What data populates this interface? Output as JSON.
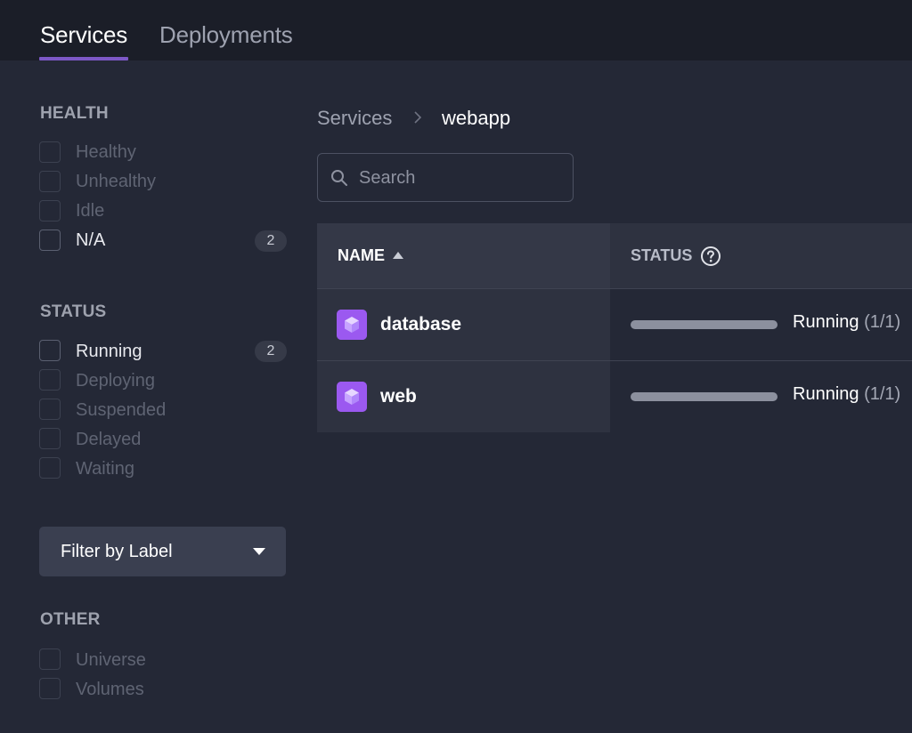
{
  "tabs": [
    {
      "label": "Services",
      "active": true
    },
    {
      "label": "Deployments",
      "active": false
    }
  ],
  "sidebar": {
    "health": {
      "title": "HEALTH",
      "items": [
        {
          "label": "Healthy",
          "count": ""
        },
        {
          "label": "Unhealthy",
          "count": ""
        },
        {
          "label": "Idle",
          "count": ""
        },
        {
          "label": "N/A",
          "count": "2"
        }
      ]
    },
    "status": {
      "title": "STATUS",
      "items": [
        {
          "label": "Running",
          "count": "2"
        },
        {
          "label": "Deploying",
          "count": ""
        },
        {
          "label": "Suspended",
          "count": ""
        },
        {
          "label": "Delayed",
          "count": ""
        },
        {
          "label": "Waiting",
          "count": ""
        }
      ]
    },
    "filter_by_label": "Filter by Label",
    "other": {
      "title": "OTHER",
      "items": [
        {
          "label": "Universe"
        },
        {
          "label": "Volumes"
        }
      ]
    }
  },
  "breadcrumb": {
    "parent": "Services",
    "current": "webapp"
  },
  "search": {
    "placeholder": "Search",
    "value": ""
  },
  "table": {
    "columns": {
      "name": "NAME",
      "status": "STATUS"
    },
    "sort": {
      "column": "NAME",
      "direction": "ascending"
    },
    "rows": [
      {
        "name": "database",
        "status": "Running",
        "instances": "(1/1)"
      },
      {
        "name": "web",
        "status": "Running",
        "instances": "(1/1)"
      }
    ]
  },
  "colors": {
    "accent": "#7d58c6",
    "service_icon": "#9b59f0",
    "background": "#242836",
    "topbar": "#1b1e28"
  },
  "icons": {
    "breadcrumb_separator": "chevron-right-icon",
    "search": "search-icon",
    "sort": "sort-asc-icon",
    "status_help": "help-icon",
    "dropdown": "caret-down-icon",
    "service": "cube-icon"
  }
}
